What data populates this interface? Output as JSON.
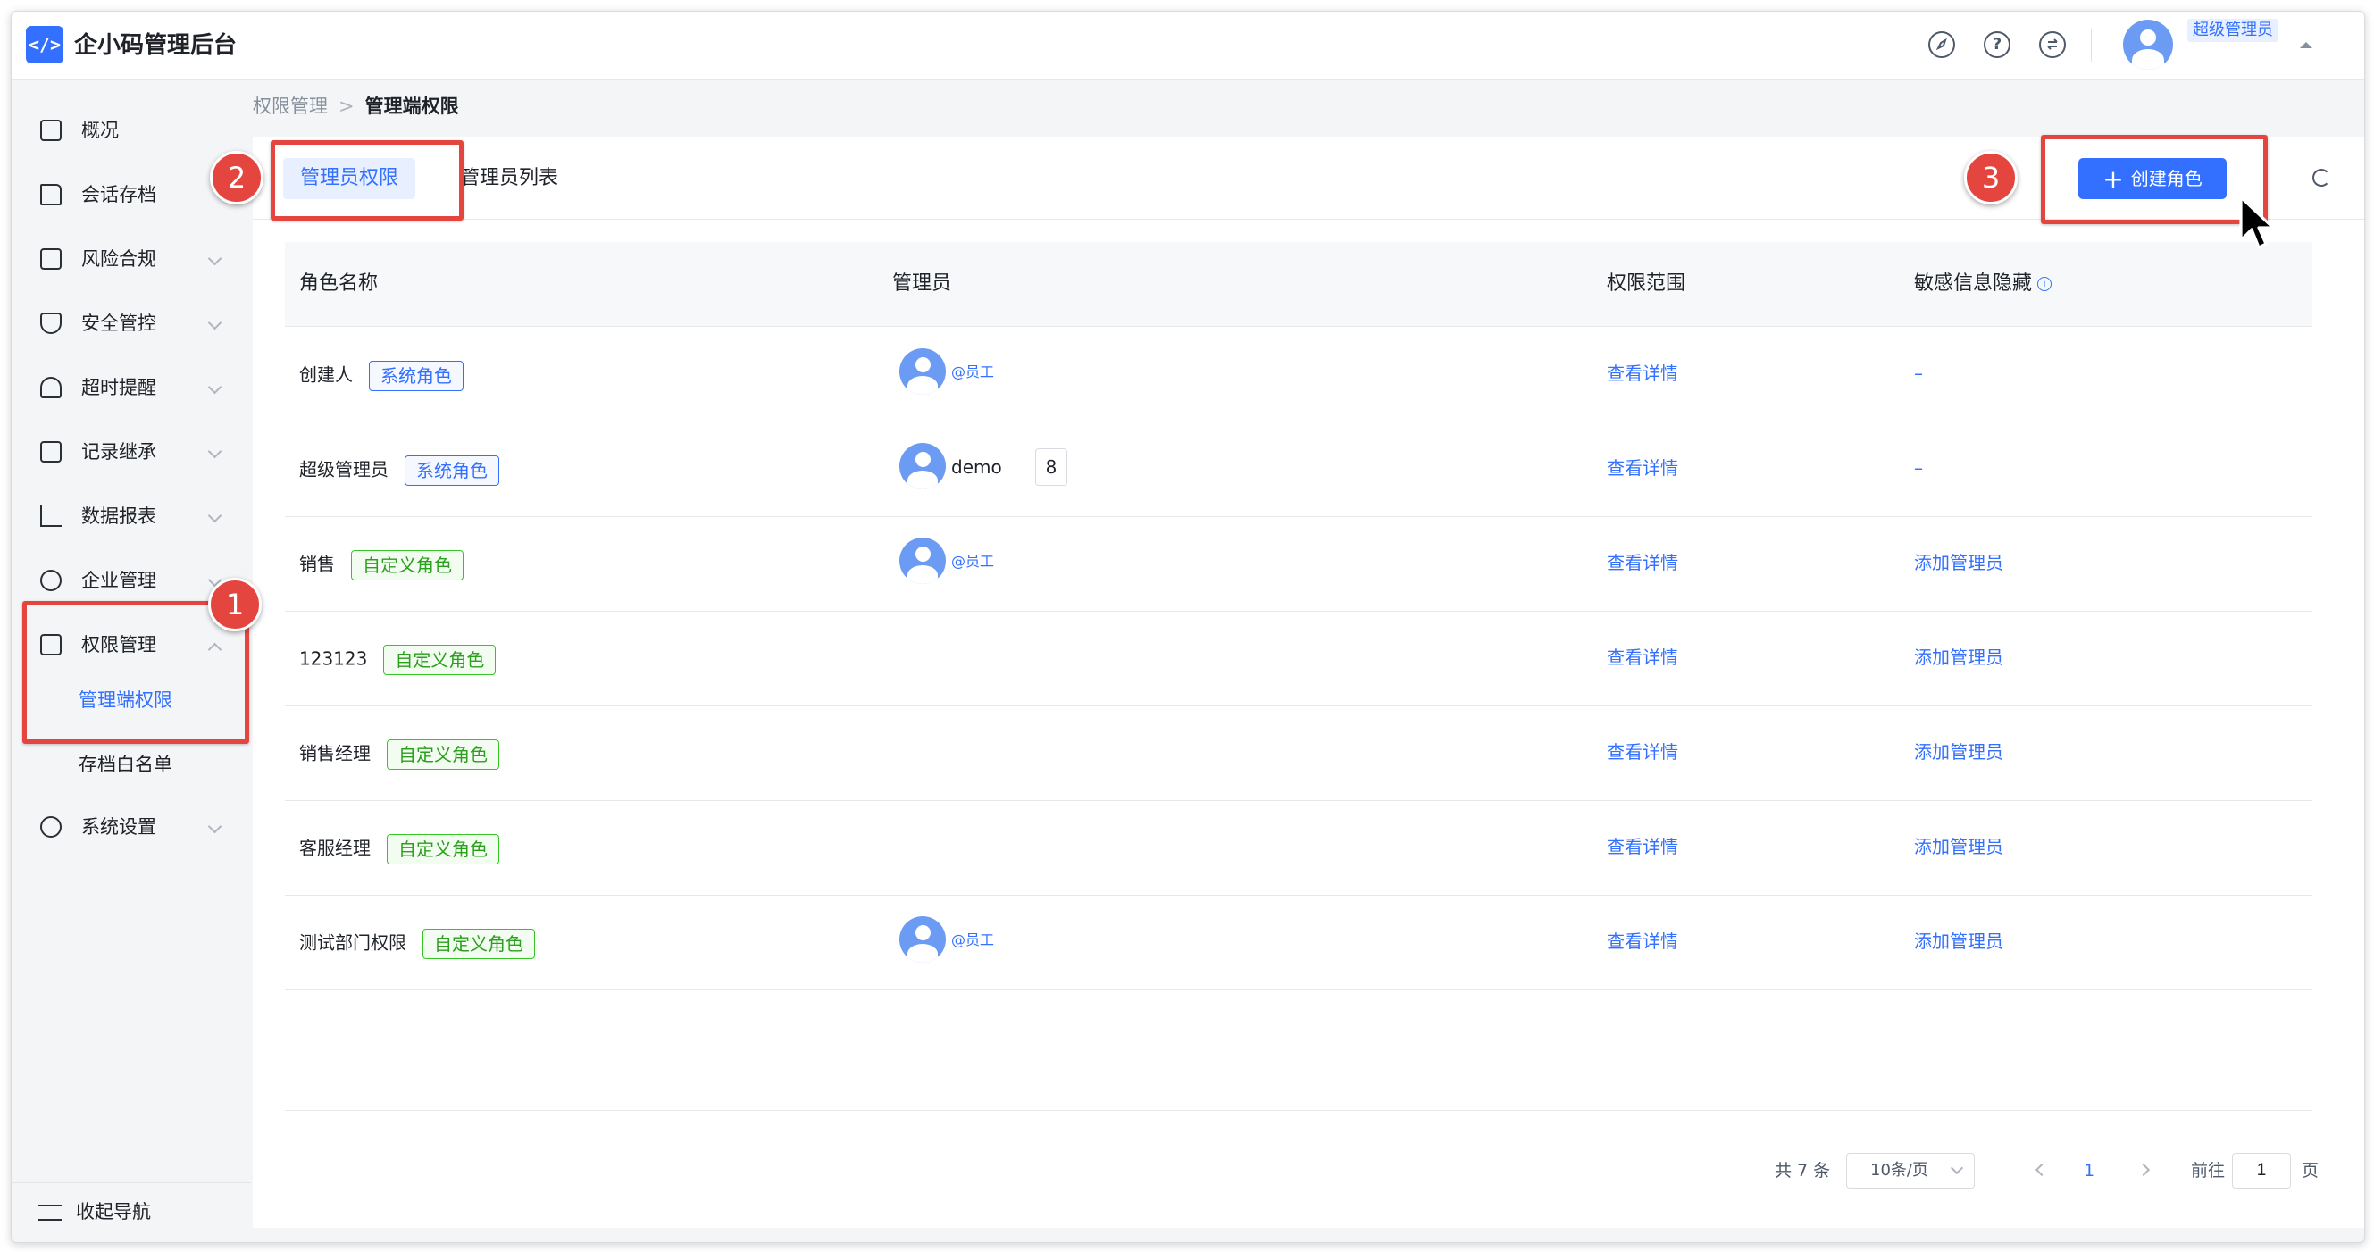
{
  "app": {
    "logo_glyph": "</>",
    "title": "企小码管理后台"
  },
  "header": {
    "icons": [
      "compass-icon",
      "help-icon",
      "exchange-icon"
    ],
    "user_role_badge": "超级管理员"
  },
  "sidebar": {
    "items": [
      {
        "label": "概况",
        "icon": "building-icon",
        "has_chevron": false
      },
      {
        "label": "会话存档",
        "icon": "folder-icon",
        "has_chevron": false
      },
      {
        "label": "风险合规",
        "icon": "alert-icon",
        "has_chevron": true
      },
      {
        "label": "安全管控",
        "icon": "shield-check-icon",
        "has_chevron": true
      },
      {
        "label": "超时提醒",
        "icon": "bell-icon",
        "has_chevron": true
      },
      {
        "label": "记录继承",
        "icon": "document-transfer-icon",
        "has_chevron": true
      },
      {
        "label": "数据报表",
        "icon": "chart-icon",
        "has_chevron": true
      },
      {
        "label": "企业管理",
        "icon": "org-tree-icon",
        "has_chevron": true
      },
      {
        "label": "权限管理",
        "icon": "permission-doc-icon",
        "has_chevron": true,
        "expanded": true
      },
      {
        "label": "系统设置",
        "icon": "settings-icon",
        "has_chevron": true
      }
    ],
    "sub_items": [
      {
        "label": "管理端权限",
        "active": true
      },
      {
        "label": "存档白名单",
        "active": false
      }
    ],
    "collapse_label": "收起导航"
  },
  "breadcrumb": {
    "parent": "权限管理",
    "separator": ">",
    "current": "管理端权限"
  },
  "tabs": [
    {
      "label": "管理员权限",
      "active": true
    },
    {
      "label": "管理员列表",
      "active": false
    }
  ],
  "create_button": {
    "label": "创建角色",
    "icon": "+"
  },
  "table": {
    "columns": [
      "角色名称",
      "管理员",
      "权限范围",
      "敏感信息隐藏"
    ],
    "info_glyph": "i",
    "rows": [
      {
        "name": "创建人",
        "tag": "系统角色",
        "tag_type": "system",
        "admin": "@员工",
        "admin_count": "",
        "scope": "查看详情",
        "hide": "–"
      },
      {
        "name": "超级管理员",
        "tag": "系统角色",
        "tag_type": "system",
        "admin": "demo",
        "admin_count": "8",
        "scope": "查看详情",
        "hide": "–"
      },
      {
        "name": "销售",
        "tag": "自定义角色",
        "tag_type": "custom",
        "admin": "@员工",
        "admin_count": "",
        "scope": "查看详情",
        "hide": "添加管理员"
      },
      {
        "name": "123123",
        "tag": "自定义角色",
        "tag_type": "custom",
        "admin": "",
        "admin_count": "",
        "scope": "查看详情",
        "hide": "添加管理员"
      },
      {
        "name": "销售经理",
        "tag": "自定义角色",
        "tag_type": "custom",
        "admin": "",
        "admin_count": "",
        "scope": "查看详情",
        "hide": "添加管理员"
      },
      {
        "name": "客服经理",
        "tag": "自定义角色",
        "tag_type": "custom",
        "admin": "",
        "admin_count": "",
        "scope": "查看详情",
        "hide": "添加管理员"
      },
      {
        "name": "测试部门权限",
        "tag": "自定义角色",
        "tag_type": "custom",
        "admin": "@员工",
        "admin_count": "",
        "scope": "查看详情",
        "hide": "添加管理员"
      }
    ]
  },
  "pagination": {
    "total": "共 7 条",
    "page_size": "10条/页",
    "current_page": "1",
    "goto_label": "前往",
    "goto_value": "1",
    "page_unit": "页"
  },
  "annotations": {
    "step1": "1",
    "step2": "2",
    "step3": "3"
  },
  "colors": {
    "primary": "#3370ff",
    "custom_tag": "#34c724",
    "annotation": "#e5453f"
  }
}
